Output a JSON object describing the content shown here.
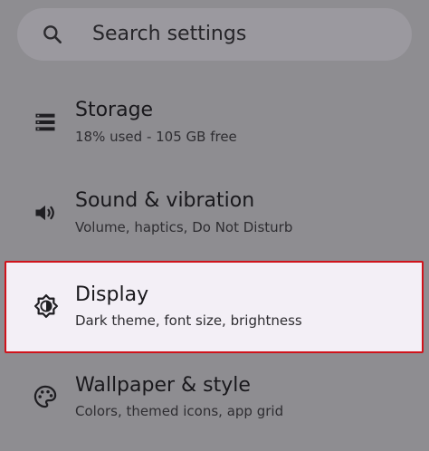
{
  "search": {
    "placeholder": "Search settings"
  },
  "settings": [
    {
      "title": "Storage",
      "subtitle": "18% used - 105 GB free",
      "icon": "storage-icon"
    },
    {
      "title": "Sound & vibration",
      "subtitle": "Volume, haptics, Do Not Disturb",
      "icon": "volume-icon"
    },
    {
      "title": "Display",
      "subtitle": "Dark theme, font size, brightness",
      "icon": "brightness-icon",
      "highlighted": true
    },
    {
      "title": "Wallpaper & style",
      "subtitle": "Colors, themed icons, app grid",
      "icon": "palette-icon"
    }
  ],
  "colors": {
    "highlight_border": "#d0131b",
    "highlight_fill": "#f3eff6",
    "dim_background": "#8e8d91"
  }
}
